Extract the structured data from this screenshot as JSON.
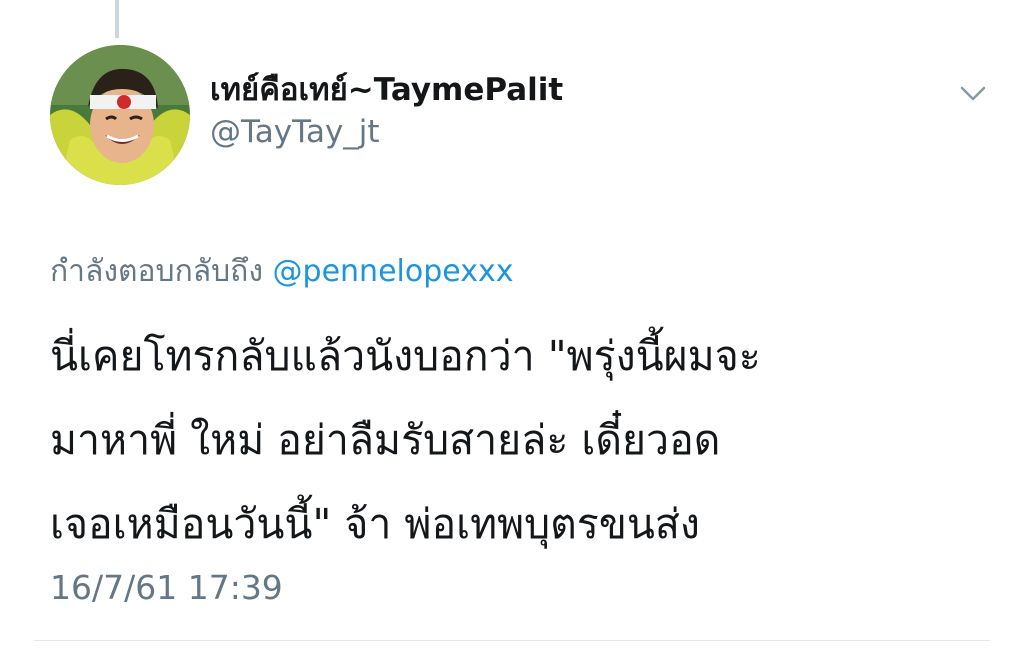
{
  "author": {
    "display_name": "เทย์คือเทย์~TaymePalit",
    "handle": "@TayTay_jt"
  },
  "reply": {
    "prefix": "กำลังตอบกลับถึง",
    "mention": "@pennelopexxx"
  },
  "tweet": {
    "lines": [
      "นี่เคยโทรกลับแล้วนังบอกว่า  \"พรุ่งนี้ผมจะ",
      "มาหาพี่ ใหม่ อย่าลืมรับสายล่ะ เดี๋ยวอด",
      "เจอเหมือนวันนี้\" จ้า พ่อเทพบุตรขนส่ง"
    ]
  },
  "timestamp": "16/7/61 17:39",
  "icons": {
    "avatar": "profile-photo",
    "caret": "chevron-down-icon"
  },
  "colors": {
    "text_primary": "#14171a",
    "text_secondary": "#657786",
    "link": "#1b95e0",
    "thread_line": "#ccd6dd"
  }
}
